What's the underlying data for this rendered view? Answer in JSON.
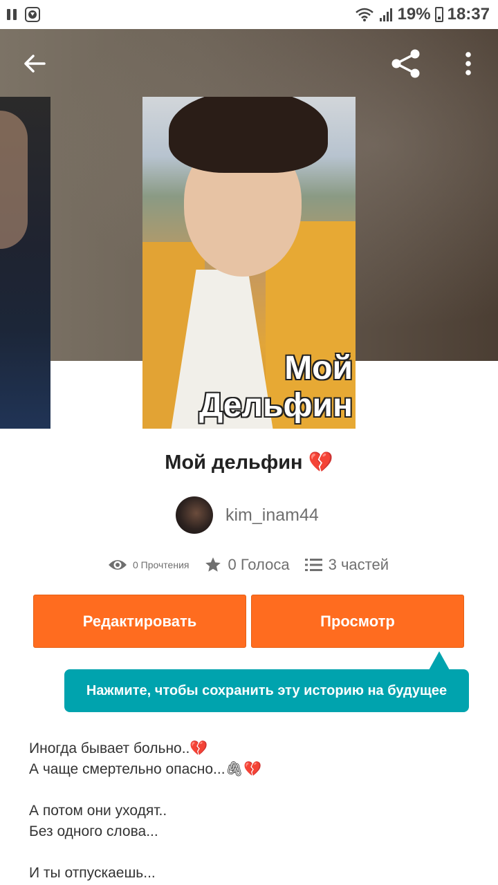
{
  "statusbar": {
    "battery": "19%",
    "time": "18:37"
  },
  "story": {
    "cover_text_line1": "Мой",
    "cover_text_line2": "Дельфин",
    "title": "Мой дельфин 💔",
    "author": "kim_inam44",
    "reads": "0 Прочтения",
    "votes": "0 Голоса",
    "parts": "3 частей"
  },
  "buttons": {
    "edit": "Редактировать",
    "view": "Просмотр"
  },
  "tooltip": "Нажмите, чтобы сохранить эту историю на будущее",
  "description": [
    "Иногда бывает больно..💔",
    "А чаще смертельно опасно...🖇💔",
    "",
    "А потом они уходят..",
    "Без одного слова...",
    "",
    "И ты отпускаешь..."
  ],
  "colors": {
    "accent": "#ff6c1f",
    "tooltip": "#00a3ae"
  }
}
